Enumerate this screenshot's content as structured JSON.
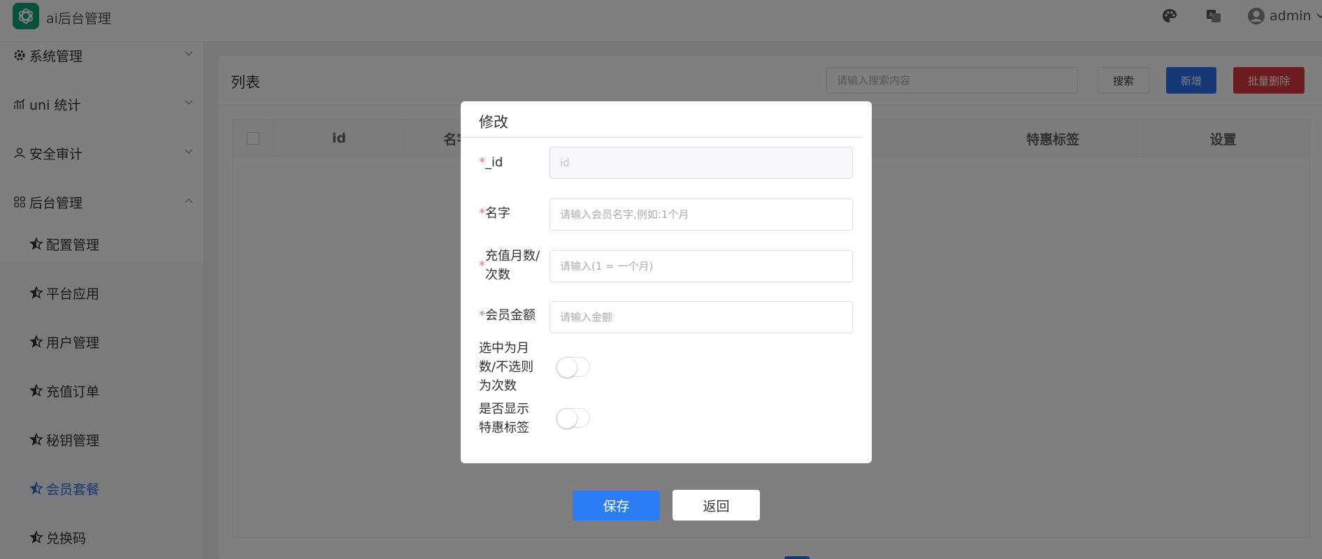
{
  "header": {
    "app_title": "ai后台管理",
    "user_name": "admin",
    "icons": [
      "openai-logo-icon",
      "palette-icon",
      "translate-icon",
      "user-avatar-icon",
      "chevron-down-icon"
    ],
    "brand_color": "#10a37f"
  },
  "sidebar": {
    "groups": [
      {
        "label": "系统管理",
        "icon": "gear-icon",
        "expanded": false
      },
      {
        "label": "uni 统计",
        "icon": "chart-icon",
        "expanded": false
      },
      {
        "label": "安全审计",
        "icon": "user-icon",
        "expanded": false
      },
      {
        "label": "后台管理",
        "icon": "grid-icon",
        "expanded": true
      }
    ],
    "items": [
      {
        "label": "配置管理"
      },
      {
        "label": "平台应用"
      },
      {
        "label": "用户管理"
      },
      {
        "label": "充值订单"
      },
      {
        "label": "秘钥管理"
      },
      {
        "label": "会员套餐",
        "active": true
      },
      {
        "label": "兑换码"
      }
    ],
    "active_color": "#2a6fd6"
  },
  "main": {
    "title": "列表",
    "search_placeholder": "请输入搜索内容",
    "search_button": "搜索",
    "add_button": "新增",
    "batch_delete_button": "批量删除",
    "table": {
      "columns": [
        "id",
        "名字",
        "特惠标签",
        "设置"
      ]
    }
  },
  "dialog": {
    "title": "修改",
    "fields": {
      "id": {
        "required": "*",
        "label": "_id",
        "placeholder": "id"
      },
      "name": {
        "required": "*",
        "label": "名字",
        "placeholder": "请输入会员名字,例如:1个月"
      },
      "count": {
        "required": "*",
        "label_line1": "充值月数/",
        "label_line2": "次数",
        "placeholder": "请输入(1 = 一个月)"
      },
      "amount": {
        "required": "*",
        "label": "会员金额",
        "placeholder": "请输入金额"
      },
      "month_toggle": {
        "label_line1": "选中为月",
        "label_line2": "数/不选则",
        "label_line3": "为次数",
        "checked": false
      },
      "tag_toggle": {
        "label_line1": "是否显示",
        "label_line2": "特惠标签",
        "checked": false
      }
    },
    "save_button": "保存",
    "back_button": "返回"
  }
}
